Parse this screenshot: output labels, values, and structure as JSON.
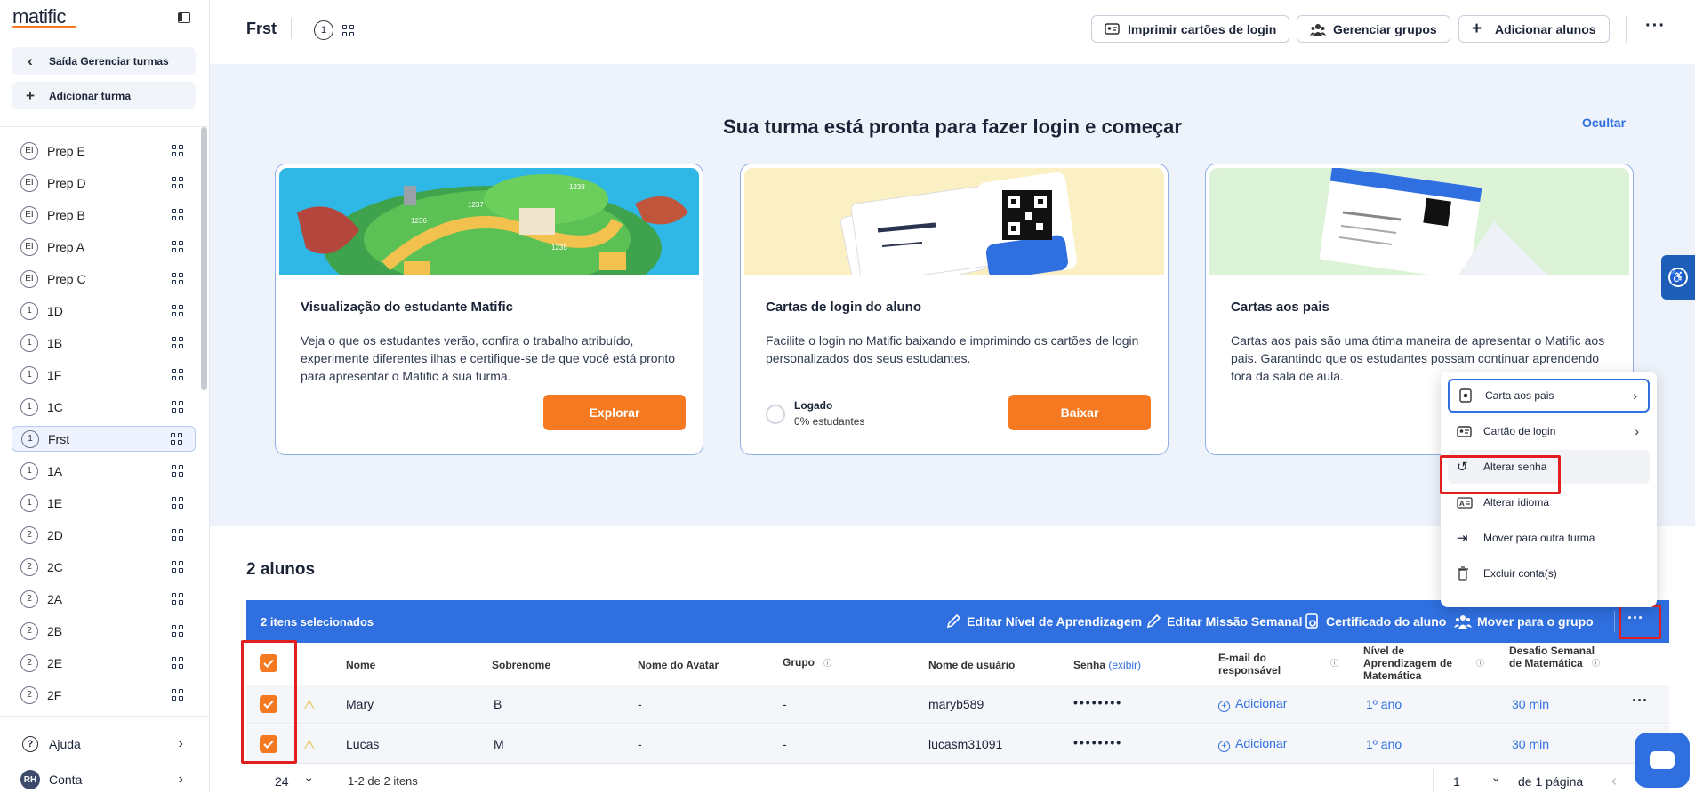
{
  "app": {
    "logo": "matific"
  },
  "sidebar": {
    "back_label": "Saída Gerenciar turmas",
    "add_label": "Adicionar turma",
    "classes": [
      {
        "grade": "EI",
        "name": "Prep E"
      },
      {
        "grade": "EI",
        "name": "Prep D"
      },
      {
        "grade": "EI",
        "name": "Prep B"
      },
      {
        "grade": "EI",
        "name": "Prep A"
      },
      {
        "grade": "EI",
        "name": "Prep C"
      },
      {
        "grade": "1",
        "name": "1D"
      },
      {
        "grade": "1",
        "name": "1B"
      },
      {
        "grade": "1",
        "name": "1F"
      },
      {
        "grade": "1",
        "name": "1C"
      },
      {
        "grade": "1",
        "name": "Frst",
        "selected": true
      },
      {
        "grade": "1",
        "name": "1A"
      },
      {
        "grade": "1",
        "name": "1E"
      },
      {
        "grade": "2",
        "name": "2D"
      },
      {
        "grade": "2",
        "name": "2C"
      },
      {
        "grade": "2",
        "name": "2A"
      },
      {
        "grade": "2",
        "name": "2B"
      },
      {
        "grade": "2",
        "name": "2E"
      },
      {
        "grade": "2",
        "name": "2F"
      }
    ],
    "help_label": "Ajuda",
    "account_label": "Conta",
    "account_initials": "RH"
  },
  "header": {
    "class_name": "Frst",
    "grade": "1",
    "print_label": "Imprimir cartões de login",
    "groups_label": "Gerenciar grupos",
    "add_students_label": "Adicionar alunos"
  },
  "banner": {
    "title": "Sua turma está pronta para fazer login e começar",
    "hide_label": "Ocultar",
    "cards": [
      {
        "title": "Visualização do estudante Matific",
        "text": "Veja o que os estudantes verão, confira o trabalho atribuído, experimente diferentes ilhas e certifique-se de que você está pronto para apresentar o Matific à sua turma.",
        "button": "Explorar"
      },
      {
        "title": "Cartas de login do aluno",
        "text": "Facilite o login no Matific baixando e imprimindo os cartões de login personalizados dos seus estudantes.",
        "button": "Baixar",
        "logged_label": "Logado",
        "logged_value": "0% estudantes"
      },
      {
        "title": "Cartas aos pais",
        "text": "Cartas aos pais são uma ótima maneira de apresentar o Matific aos pais. Garantindo que os estudantes possam continuar aprendendo fora da sala de aula."
      }
    ],
    "island_levels": [
      "1236",
      "1237",
      "1238",
      "1235"
    ]
  },
  "students": {
    "count_label": "2 alunos",
    "selected_label": "2 itens selecionados",
    "actions": {
      "edit_level": "Editar Nível de Aprendizagem",
      "edit_mission": "Editar Missão Semanal",
      "certificate": "Certificado do aluno",
      "move_group": "Mover para o grupo"
    },
    "columns": {
      "first_name": "Nome",
      "last_name": "Sobrenome",
      "avatar": "Nome do Avatar",
      "group": "Grupo",
      "username": "Nome de usuário",
      "password": "Senha",
      "password_show": "(exibir)",
      "email": "E-mail do responsável",
      "level": "Nível de Aprendizagem de Matemática",
      "challenge": "Desafio Semanal de Matemática"
    },
    "rows": [
      {
        "first": "Mary",
        "last": "B",
        "avatar": "-",
        "group": "-",
        "username": "maryb589",
        "password": "••••••••",
        "email": "Adicionar",
        "level": "1º ano",
        "challenge": "30 min"
      },
      {
        "first": "Lucas",
        "last": "M",
        "avatar": "-",
        "group": "-",
        "username": "lucasm31091",
        "password": "••••••••",
        "email": "Adicionar",
        "level": "1º ano",
        "challenge": "30 min"
      }
    ],
    "pagination": {
      "per_page": "24",
      "range": "1-2 de 2 itens",
      "page": "1",
      "total_pages": "de 1 página"
    }
  },
  "menu": {
    "items": [
      "Carta aos pais",
      "Cartão de login",
      "Alterar senha",
      "Alterar idioma",
      "Mover para outra turma",
      "Excluir conta(s)"
    ]
  },
  "colors": {
    "primary": "#2f6fe0",
    "accent": "#f47920",
    "highlight": "#e02020"
  }
}
